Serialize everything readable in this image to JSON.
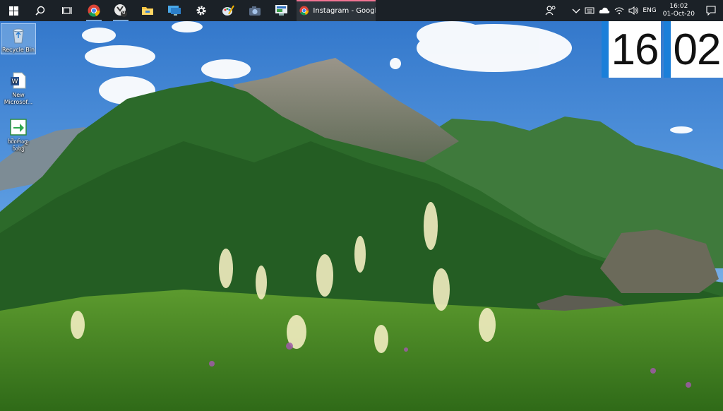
{
  "taskbar": {
    "pinned": [
      {
        "name": "start-button",
        "icon": "windows-logo-icon"
      },
      {
        "name": "search-button",
        "icon": "search-icon"
      },
      {
        "name": "task-view-button",
        "icon": "task-view-icon"
      },
      {
        "name": "chrome-button",
        "icon": "chrome-icon"
      },
      {
        "name": "viber-button",
        "icon": "viber-icon",
        "badge": "0"
      },
      {
        "name": "file-explorer-button",
        "icon": "folder-icon"
      },
      {
        "name": "remote-desktop-button",
        "icon": "monitor-icon"
      },
      {
        "name": "settings-button",
        "icon": "gear-icon"
      },
      {
        "name": "paint-button",
        "icon": "paint-icon"
      },
      {
        "name": "camera-button",
        "icon": "camera-icon"
      },
      {
        "name": "control-panel-button",
        "icon": "control-panel-icon"
      }
    ],
    "open_window": {
      "title": "Instagram - Google...",
      "icon": "chrome-icon"
    },
    "tray": {
      "language": "ENG",
      "time": "16:02",
      "date": "01-Oct-20"
    }
  },
  "desktop_icons": [
    {
      "label": "Recycle Bin",
      "icon": "recycle-bin-icon"
    },
    {
      "label": "New Microsof...",
      "icon": "word-document-icon"
    },
    {
      "label": "ხშირად ნახვ",
      "icon": "shortcut-icon"
    }
  ],
  "clock_widget": {
    "hours": "16",
    "minutes": "02"
  },
  "colors": {
    "taskbar_bg": "#1b2127",
    "accent": "#1b7fd9",
    "window_indicator": "#f27493"
  }
}
